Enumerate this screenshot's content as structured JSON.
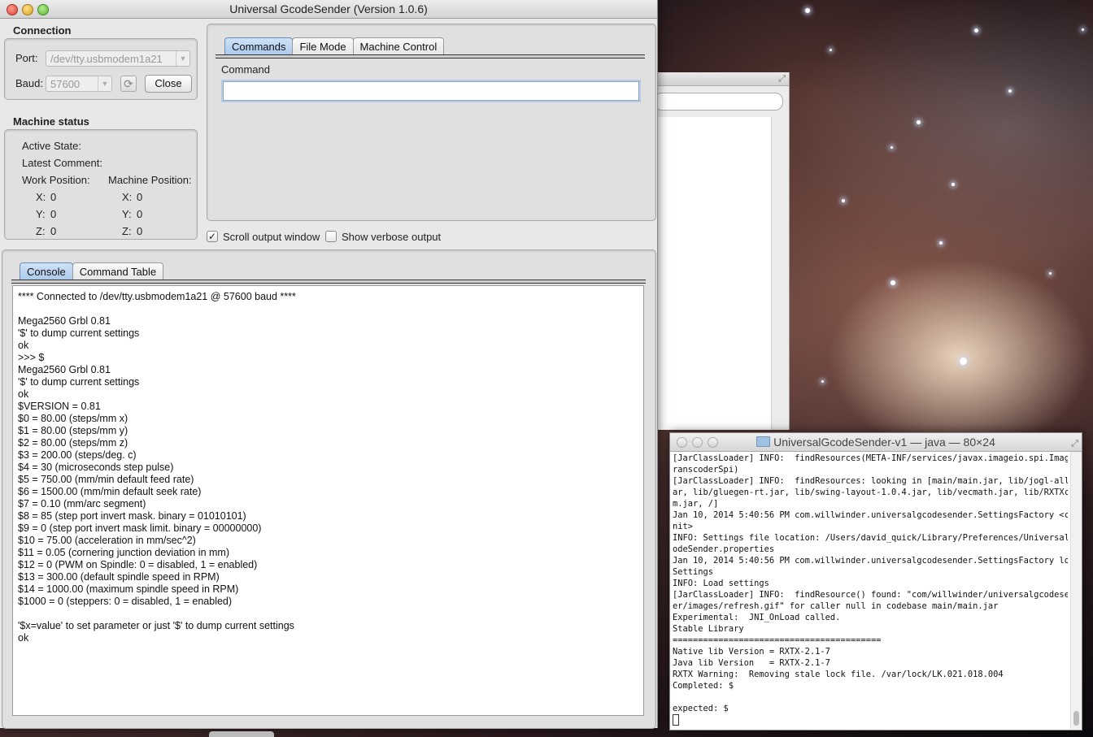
{
  "window": {
    "title": "Universal GcodeSender (Version 1.0.6)"
  },
  "connection": {
    "section_label": "Connection",
    "port_label": "Port:",
    "port_value": "/dev/tty.usbmodem1a21",
    "baud_label": "Baud:",
    "baud_value": "57600",
    "close_label": "Close"
  },
  "machine_status": {
    "section_label": "Machine status",
    "active_state_label": "Active State:",
    "latest_comment_label": "Latest Comment:",
    "work_position_label": "Work Position:",
    "machine_position_label": "Machine Position:",
    "work": {
      "x_label": "X:",
      "x": "0",
      "y_label": "Y:",
      "y": "0",
      "z_label": "Z:",
      "z": "0"
    },
    "machine": {
      "x_label": "X:",
      "x": "0",
      "y_label": "Y:",
      "y": "0",
      "z_label": "Z:",
      "z": "0"
    }
  },
  "command_tabs": [
    {
      "label": "Commands",
      "active": true
    },
    {
      "label": "File Mode",
      "active": false
    },
    {
      "label": "Machine Control",
      "active": false
    }
  ],
  "command": {
    "label": "Command",
    "value": ""
  },
  "options": {
    "scroll_output_label": "Scroll output window",
    "scroll_output_checked": true,
    "verbose_label": "Show verbose output",
    "verbose_checked": false
  },
  "console_tabs": [
    {
      "label": "Console",
      "active": true
    },
    {
      "label": "Command Table",
      "active": false
    }
  ],
  "console_lines": [
    "**** Connected to /dev/tty.usbmodem1a21 @ 57600 baud ****",
    "",
    "Mega2560 Grbl 0.81",
    "'$' to dump current settings",
    "ok",
    ">>> $",
    "Mega2560 Grbl 0.81",
    "'$' to dump current settings",
    "ok",
    "$VERSION = 0.81",
    "$0 = 80.00 (steps/mm x)",
    "$1 = 80.00 (steps/mm y)",
    "$2 = 80.00 (steps/mm z)",
    "$3 = 200.00 (steps/deg. c)",
    "$4 = 30 (microseconds step pulse)",
    "$5 = 750.00 (mm/min default feed rate)",
    "$6 = 1500.00 (mm/min default seek rate)",
    "$7 = 0.10 (mm/arc segment)",
    "$8 = 85 (step port invert mask. binary = 01010101)",
    "$9 = 0 (step port invert mask limit. binary = 00000000)",
    "$10 = 75.00 (acceleration in mm/sec^2)",
    "$11 = 0.05 (cornering junction deviation in mm)",
    "$12 = 0 (PWM on Spindle: 0 = disabled, 1 = enabled)",
    "$13 = 300.00 (default spindle speed in RPM)",
    "$14 = 1000.00 (maximum spindle speed in RPM)",
    "$1000 = 0 (steppers: 0 = disabled, 1 = enabled)",
    "",
    "'$x=value' to set parameter or just '$' to dump current settings",
    "ok"
  ],
  "terminal": {
    "title": "UniversalGcodeSender-v1 — java — 80×24",
    "lines": [
      "[JarClassLoader] INFO:  findResources(META-INF/services/javax.imageio.spi.ImageT",
      "ranscoderSpi)",
      "[JarClassLoader] INFO:  findResources: looking in [main/main.jar, lib/jogl-all.j",
      "ar, lib/gluegen-rt.jar, lib/swing-layout-1.0.4.jar, lib/vecmath.jar, lib/RXTXcom",
      "m.jar, /]",
      "Jan 10, 2014 5:40:56 PM com.willwinder.universalgcodesender.SettingsFactory <cli",
      "nit>",
      "INFO: Settings file location: /Users/david_quick/Library/Preferences/UniversalGc",
      "odeSender.properties",
      "Jan 10, 2014 5:40:56 PM com.willwinder.universalgcodesender.SettingsFactory load",
      "Settings",
      "INFO: Load settings",
      "[JarClassLoader] INFO:  findResource() found: \"com/willwinder/universalgcodesend",
      "er/images/refresh.gif\" for caller null in codebase main/main.jar",
      "Experimental:  JNI_OnLoad called.",
      "Stable Library",
      "=========================================",
      "Native lib Version = RXTX-2.1-7",
      "Java lib Version   = RXTX-2.1-7",
      "RXTX Warning:  Removing stale lock file. /var/lock/LK.021.018.004",
      "Completed: $",
      "",
      "expected: $"
    ]
  },
  "colors": {
    "active_tab": "#a9c8ec",
    "window_bg": "#e8e8e8",
    "close_light": "#d9412f",
    "minimize_light": "#d9a21c",
    "zoom_light": "#59b637"
  },
  "icons": {
    "refresh": "refresh-icon",
    "dropdown": "chevron-down-icon",
    "folder": "folder-icon"
  }
}
